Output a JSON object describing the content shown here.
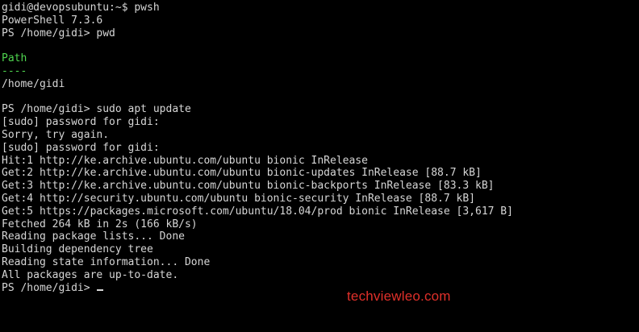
{
  "colors": {
    "background": "#000000",
    "foreground": "#d6d6d6",
    "path_header": "#4fd64f",
    "watermark": "#e0302a"
  },
  "terminal": {
    "lines": [
      "gidi@devopsubuntu:~$ pwsh",
      "PowerShell 7.3.6",
      "PS /home/gidi> pwd",
      "",
      "Path",
      "----",
      "/home/gidi",
      "",
      "PS /home/gidi> sudo apt update",
      "[sudo] password for gidi:",
      "Sorry, try again.",
      "[sudo] password for gidi:",
      "Hit:1 http://ke.archive.ubuntu.com/ubuntu bionic InRelease",
      "Get:2 http://ke.archive.ubuntu.com/ubuntu bionic-updates InRelease [88.7 kB]",
      "Get:3 http://ke.archive.ubuntu.com/ubuntu bionic-backports InRelease [83.3 kB]",
      "Get:4 http://security.ubuntu.com/ubuntu bionic-security InRelease [88.7 kB]",
      "Get:5 https://packages.microsoft.com/ubuntu/18.04/prod bionic InRelease [3,617 B]",
      "Fetched 264 kB in 2s (166 kB/s)",
      "Reading package lists... Done",
      "Building dependency tree",
      "Reading state information... Done",
      "All packages are up-to-date."
    ],
    "prompt": "PS /home/gidi> "
  },
  "watermark": "techviewleo.com"
}
